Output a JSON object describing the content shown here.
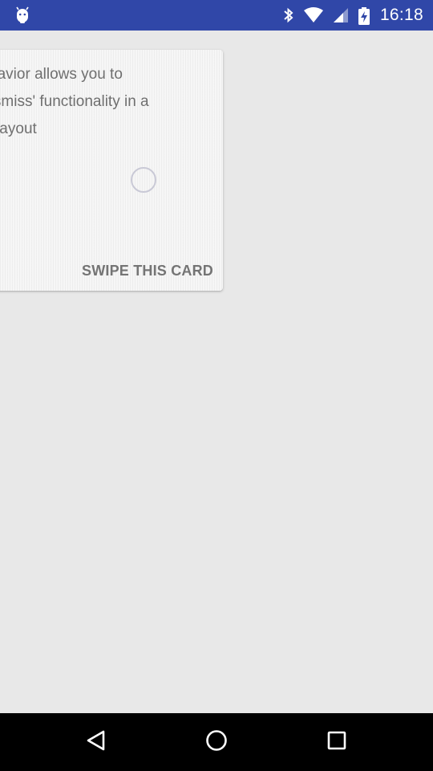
{
  "status_bar": {
    "background": "#3047a8",
    "left_icon": "android-debug-icon",
    "icons": [
      "bluetooth-icon",
      "wifi-icon",
      "cellular-signal-icon",
      "battery-charging-icon"
    ],
    "time": "16:18"
  },
  "card": {
    "lines": [
      "' behavior allows you to",
      "to dismiss' functionality in a",
      "atorLayout"
    ],
    "progress_icon": "loading-spinner-icon",
    "action_label": "SWIPE THIS CARD"
  },
  "nav_bar": {
    "buttons": [
      {
        "icon": "back-triangle-icon"
      },
      {
        "icon": "home-circle-icon"
      },
      {
        "icon": "recents-square-icon"
      }
    ]
  }
}
